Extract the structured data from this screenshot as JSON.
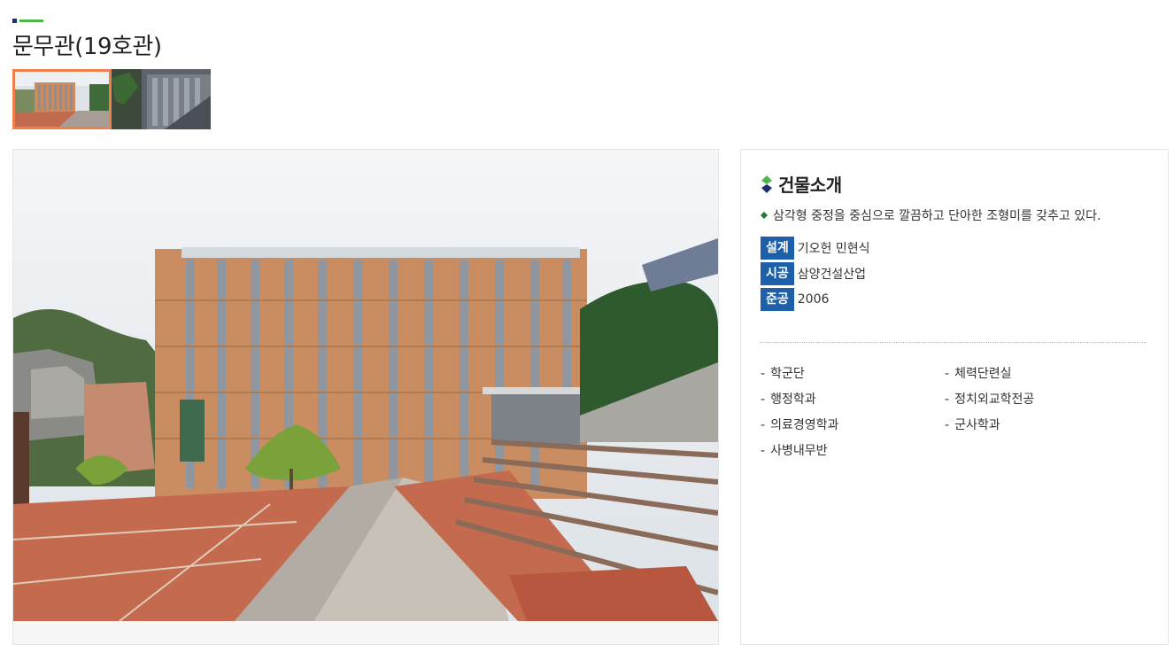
{
  "page": {
    "title": "문무관(19호관)"
  },
  "thumbnails": [
    {
      "label": "building-front",
      "active": true
    },
    {
      "label": "building-side",
      "active": false
    }
  ],
  "info": {
    "section_title": "건물소개",
    "description": "삼각형 중정을 중심으로 깔끔하고 단아한 조형미를 갖추고 있다.",
    "facts": [
      {
        "label": "설계",
        "value": "기오헌 민현식"
      },
      {
        "label": "시공",
        "value": "삼양건설산업"
      },
      {
        "label": "준공",
        "value": "2006"
      }
    ],
    "departments": [
      "학군단",
      "체력단련실",
      "행정학과",
      "정치외교학전공",
      "의료경영학과",
      "군사학과",
      "사병내무반"
    ],
    "dash": "-"
  },
  "colors": {
    "accent_orange": "#f07f4f",
    "label_blue": "#1d5fa8",
    "deco_green": "#4db84a",
    "deco_navy": "#1a2f6b"
  }
}
